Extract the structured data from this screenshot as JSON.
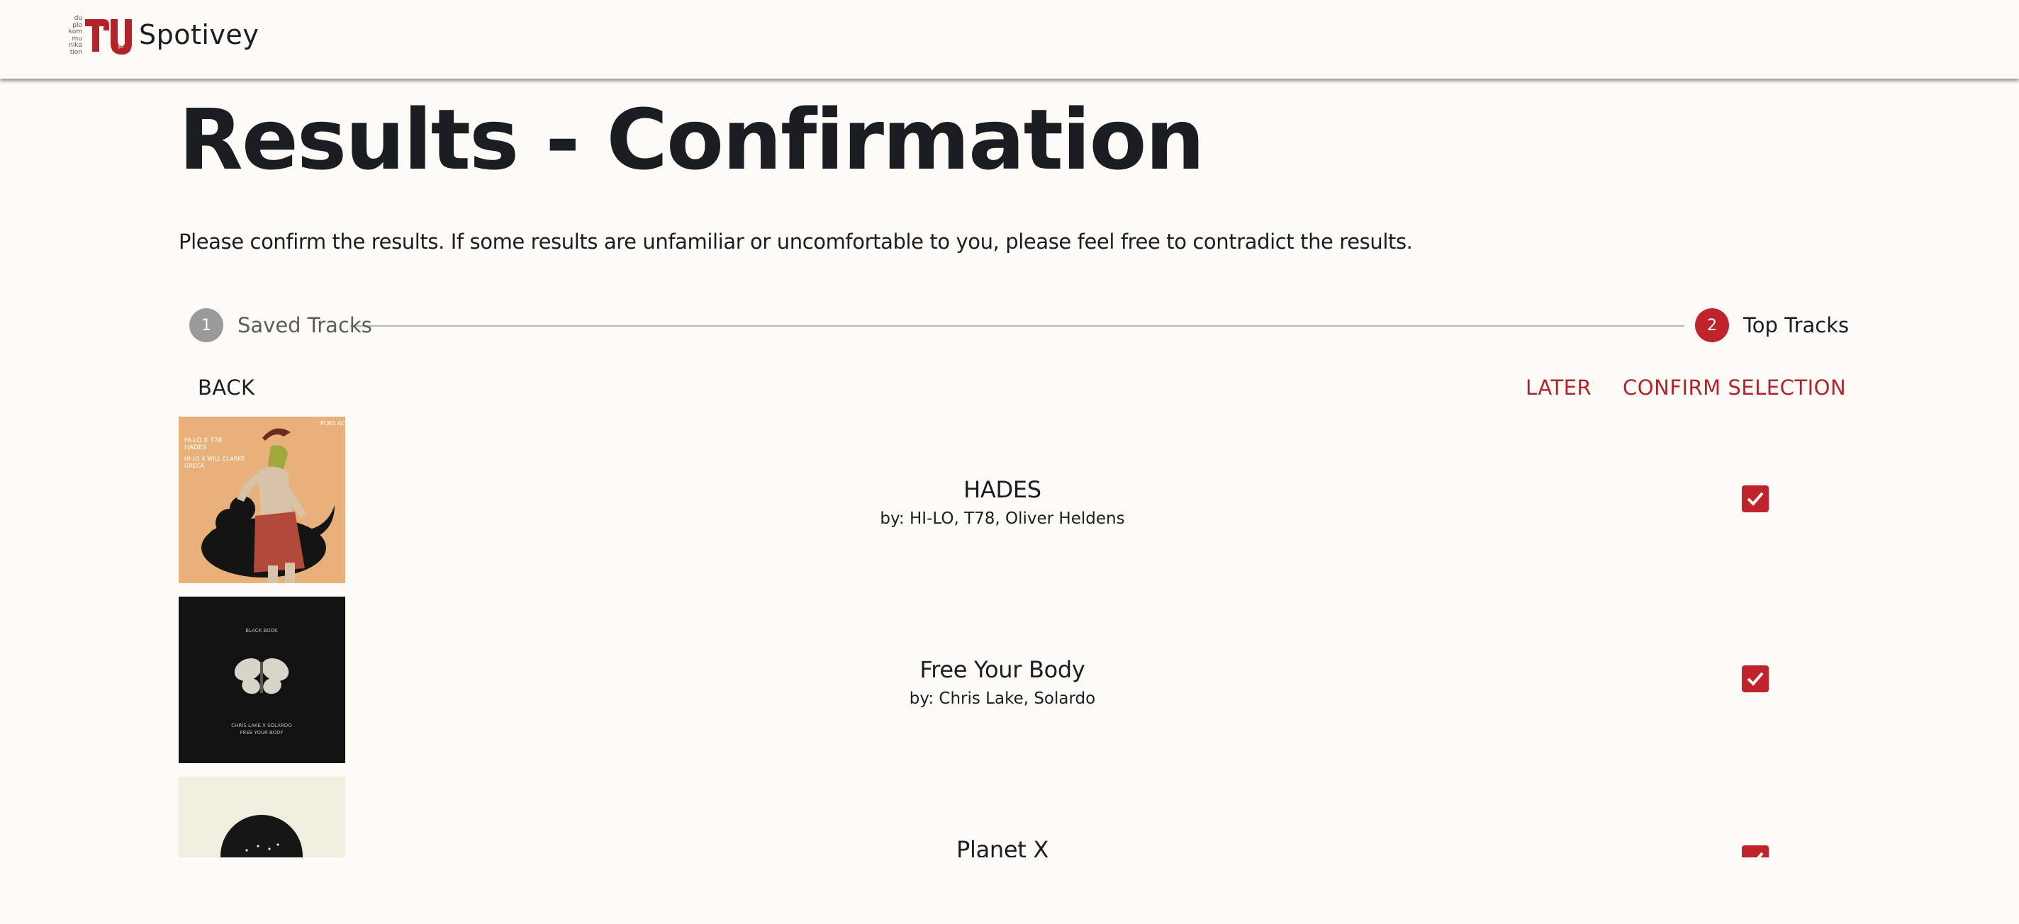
{
  "header": {
    "logo_lines": [
      "du",
      "plo",
      "kom",
      "mu",
      "nika",
      "tion"
    ],
    "logo_badge": "TUB",
    "app_name": "Spotivey"
  },
  "page": {
    "title": "Results - Confirmation",
    "intro": "Please confirm the results. If some results are unfamiliar or uncomfortable to you, please feel free to contradict the results."
  },
  "stepper": {
    "steps": [
      {
        "number": "1",
        "label": "Saved Tracks",
        "state": "completed"
      },
      {
        "number": "2",
        "label": "Top Tracks",
        "state": "active"
      }
    ]
  },
  "actions": {
    "back_label": "BACK",
    "later_label": "LATER",
    "confirm_label": "CONFIRM SELECTION"
  },
  "tracks": [
    {
      "title": "HADES",
      "artists": "by: HI-LO, T78, Oliver Heldens",
      "checked": true,
      "cover": {
        "lines": [
          "HI-LO X T78",
          "HADES",
          "HI-LO X WILL CLARKE",
          "GRECA"
        ],
        "label": "PURE ACID",
        "colors": {
          "bg": "#e8b07a"
        }
      }
    },
    {
      "title": "Free Your Body",
      "artists": "by: Chris Lake, Solardo",
      "checked": true,
      "cover": {
        "top": "BLACK BOOK",
        "lines": [
          "CHRIS LAKE X SOLARDO",
          "FREE YOUR BODY"
        ],
        "colors": {
          "bg": "#121212"
        }
      }
    },
    {
      "title": "Planet X",
      "artists": "",
      "checked": true,
      "cover": {
        "colors": {
          "bg": "#f1eedf"
        }
      }
    }
  ],
  "colors": {
    "accent": "#c0232b",
    "text": "#1c1d22",
    "background": "#fcfbf7",
    "inactive_step": "#9a9a9a"
  }
}
